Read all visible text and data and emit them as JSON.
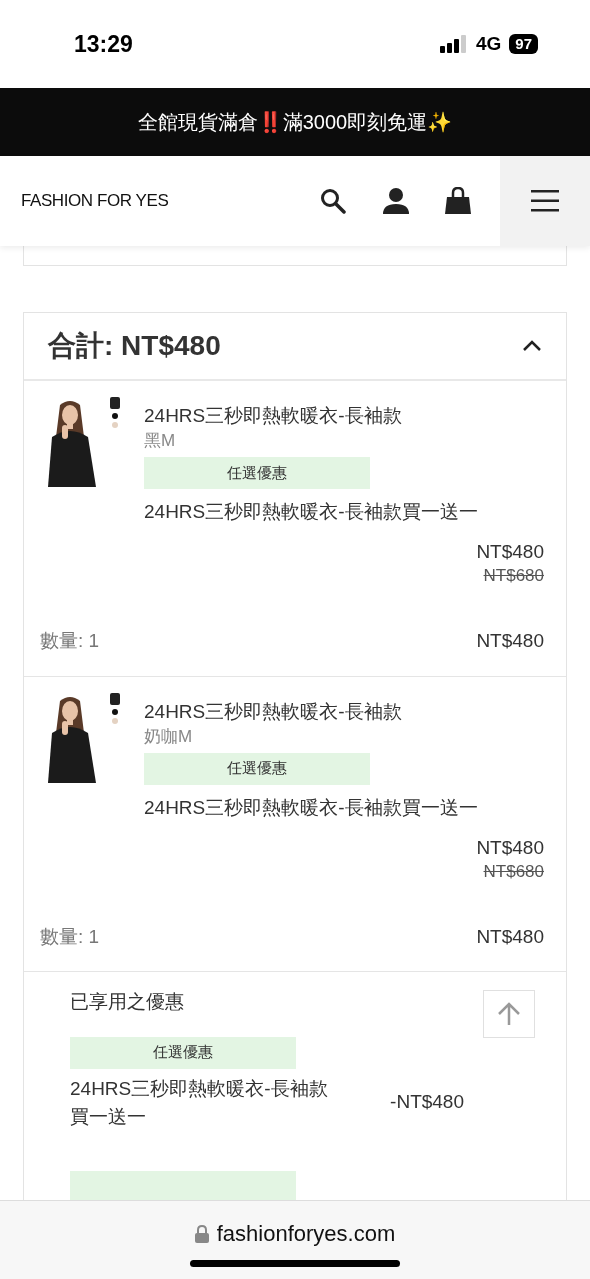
{
  "status_bar": {
    "time": "13:29",
    "network": "4G",
    "battery": "97"
  },
  "banner": {
    "text_before": "全館現貨滿倉",
    "emoji_alert": "‼️",
    "text_after": "滿3000即刻免運",
    "emoji_end": "✨"
  },
  "header": {
    "logo": "FASHION FOR YES"
  },
  "summary": {
    "title": "合計: NT$480",
    "expanded": true
  },
  "items": [
    {
      "kind": "picture",
      "name": "24HRS三秒即熱軟暖衣-長袖款",
      "variant": "黑M",
      "tag": "任選優惠",
      "promo": "24HRS三秒即熱軟暖衣-長袖款買一送一",
      "price": "NT$480",
      "original_price": "NT$680",
      "quantity": "數量: 1",
      "subtotal": "NT$480"
    },
    {
      "kind": "picture",
      "name": "24HRS三秒即熱軟暖衣-長袖款",
      "variant": "奶咖M",
      "tag": "任選優惠",
      "promo": "24HRS三秒即熱軟暖衣-長袖款買一送一",
      "price": "NT$480",
      "original_price": "NT$680",
      "quantity": "數量: 1",
      "subtotal": "NT$480"
    }
  ],
  "discounts": {
    "title": "已享用之優惠",
    "entries": [
      {
        "tag": "任選優惠",
        "description": "24HRS三秒即熱軟暖衣-長袖款買一送一",
        "amount": "-NT$480"
      }
    ]
  },
  "browser": {
    "url": "fashionforyes.com"
  }
}
